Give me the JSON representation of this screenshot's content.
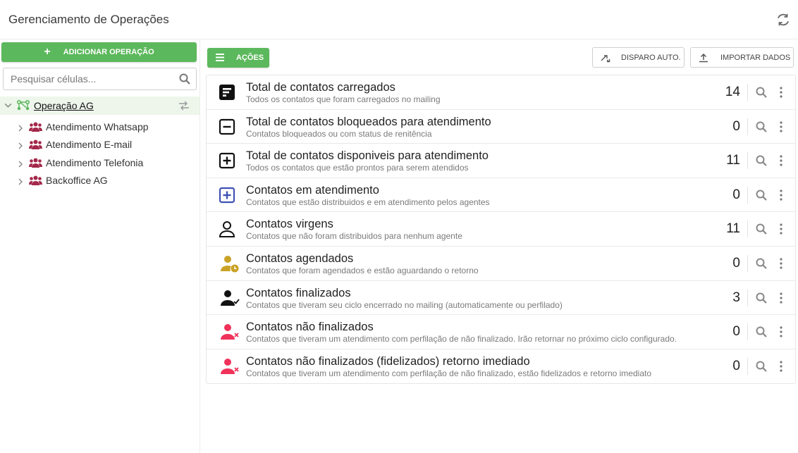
{
  "header": {
    "title": "Gerenciamento de Operações",
    "refresh_icon": "refresh-icon"
  },
  "sidebar": {
    "add_button_label": "ADICIONAR OPERAÇÃO",
    "search_placeholder": "Pesquisar células...",
    "operation": {
      "label": "Operação AG",
      "color": "#5cb85c"
    },
    "cells": [
      {
        "label": "Atendimento Whatsapp"
      },
      {
        "label": "Atendimento E-mail"
      },
      {
        "label": "Atendimento Telefonia"
      },
      {
        "label": "Backoffice AG"
      }
    ],
    "cell_icon_color": "#a3284a"
  },
  "toolbar": {
    "acoes_label": "AÇÕES",
    "disparo_label": "DISPARO AUTO.",
    "importar_label": "IMPORTAR DADOS",
    "accent": "#5cb85c"
  },
  "rows": [
    {
      "icon": "list-box-icon",
      "title": "Total de contatos carregados",
      "subtitle": "Todos os contatos que foram carregados no mailing",
      "count": "14"
    },
    {
      "icon": "minus-box-icon",
      "title": "Total de contatos bloqueados para atendimento",
      "subtitle": "Contatos bloqueados ou com status de renitência",
      "count": "0"
    },
    {
      "icon": "plus-box-icon",
      "title": "Total de contatos disponiveis para atendimento",
      "subtitle": "Todos os contatos que estão prontos para serem atendidos",
      "count": "11"
    },
    {
      "icon": "plus-box-blue-icon",
      "title": "Contatos em atendimento",
      "subtitle": "Contatos que estão distribuidos e em atendimento pelos agentes",
      "count": "0"
    },
    {
      "icon": "person-outline-icon",
      "title": "Contatos virgens",
      "subtitle": "Contatos que não foram distribuidos para nenhum agente",
      "count": "11"
    },
    {
      "icon": "person-clock-icon",
      "title": "Contatos agendados",
      "subtitle": "Contatos que foram agendados e estão aguardando o retorno",
      "count": "0"
    },
    {
      "icon": "person-check-icon",
      "title": "Contatos finalizados",
      "subtitle": "Contatos que tiveram seu ciclo encerrado no mailing (automaticamente ou perfilado)",
      "count": "3"
    },
    {
      "icon": "person-x-icon",
      "title": "Contatos não finalizados",
      "subtitle": "Contatos que tiveram um atendimento com perfilação de não finalizado. Irão retornar no próximo ciclo configurado.",
      "count": "0"
    },
    {
      "icon": "person-x-icon",
      "title": "Contatos não finalizados (fidelizados) retorno imediado",
      "subtitle": "Contatos que tiveram um atendimento com perfilação de não finalizado, estão fidelizados e retorno imediato",
      "count": "0"
    }
  ],
  "colors": {
    "blue": "#3f51b5",
    "gold": "#c9a227",
    "red": "#f0325a"
  }
}
